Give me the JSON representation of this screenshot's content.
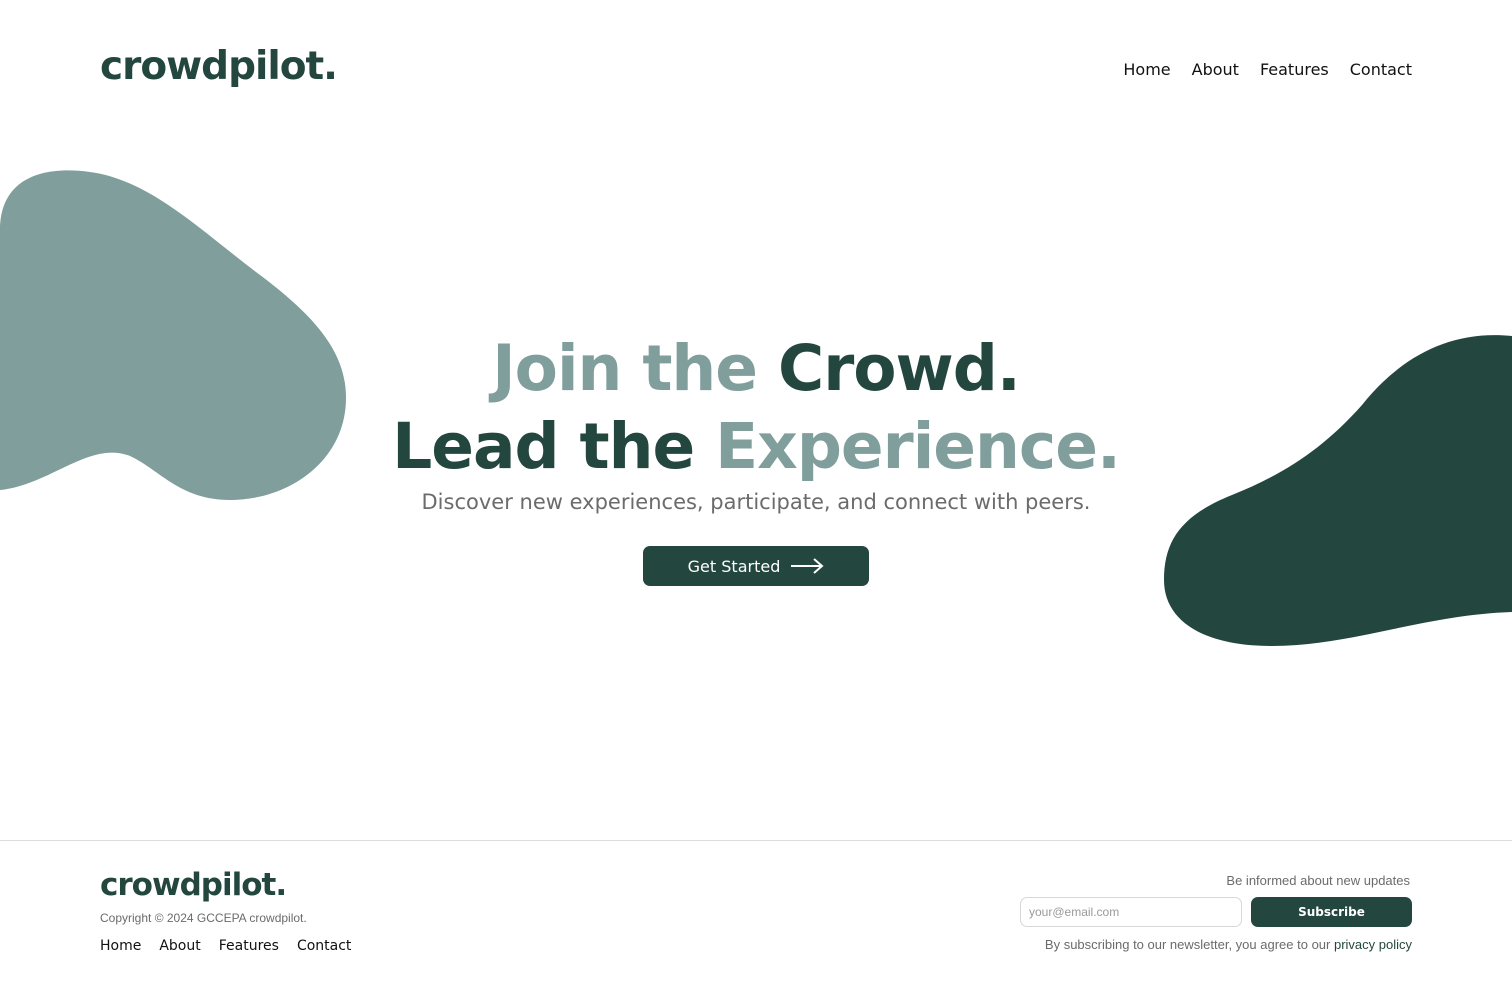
{
  "brand": {
    "name": "crowdpilot."
  },
  "nav": {
    "items": [
      "Home",
      "About",
      "Features",
      "Contact"
    ]
  },
  "hero": {
    "line1_muted": "Join the",
    "line1_dark": "Crowd.",
    "line2_dark": "Lead the",
    "line2_muted": "Experience.",
    "subtitle": "Discover new experiences, participate, and connect with peers.",
    "cta_label": "Get Started",
    "cta_icon": "arrow-right-icon"
  },
  "footer": {
    "brand": "crowdpilot.",
    "copyright": "Copyright © 2024 GCCEPA crowdpilot.",
    "nav": [
      "Home",
      "About",
      "Features",
      "Contact"
    ],
    "newsletter_label": "Be informed about new updates",
    "email_placeholder": "your@email.com",
    "subscribe_label": "Subscribe",
    "legal_text": "By subscribing to our newsletter, you agree to our ",
    "legal_link": "privacy policy"
  },
  "colors": {
    "brand_dark": "#23473e",
    "brand_muted": "#7f9e9c",
    "text_gray": "#6b6b6b"
  }
}
